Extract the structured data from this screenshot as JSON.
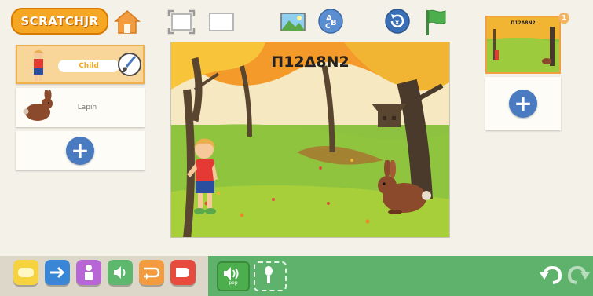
{
  "app": {
    "logo": "SCRATCHJR",
    "colors": {
      "accent": "#f5a623",
      "blue": "#4a7bc0",
      "palette_bg": "#dcd7c8",
      "blockarea": "#5fb26c"
    }
  },
  "toolbar": {
    "home": "home-icon",
    "fullscreen": "fullscreen-icon",
    "grid": "grid-icon",
    "background": "background-icon",
    "text": "text-icon",
    "reset": "reset-icon",
    "flag": "green-flag-icon"
  },
  "sprites": [
    {
      "name": "Child",
      "selected": true
    },
    {
      "name": "Lapin",
      "selected": false
    }
  ],
  "stage": {
    "title": "П12Δ8N2"
  },
  "pages": {
    "thumb_title": "П12Δ8N2",
    "count_badge": "1"
  },
  "palette": {
    "categories": [
      {
        "name": "triggers",
        "color": "#f5d23e"
      },
      {
        "name": "motion",
        "color": "#3a86d6"
      },
      {
        "name": "looks",
        "color": "#b865d6"
      },
      {
        "name": "sound",
        "color": "#5db86e"
      },
      {
        "name": "control",
        "color": "#f39c3f"
      },
      {
        "name": "end",
        "color": "#e64b3e"
      }
    ],
    "blocks": [
      {
        "name": "play-sound-block",
        "label": "pop"
      },
      {
        "name": "record-sound-block",
        "label": ""
      }
    ]
  }
}
